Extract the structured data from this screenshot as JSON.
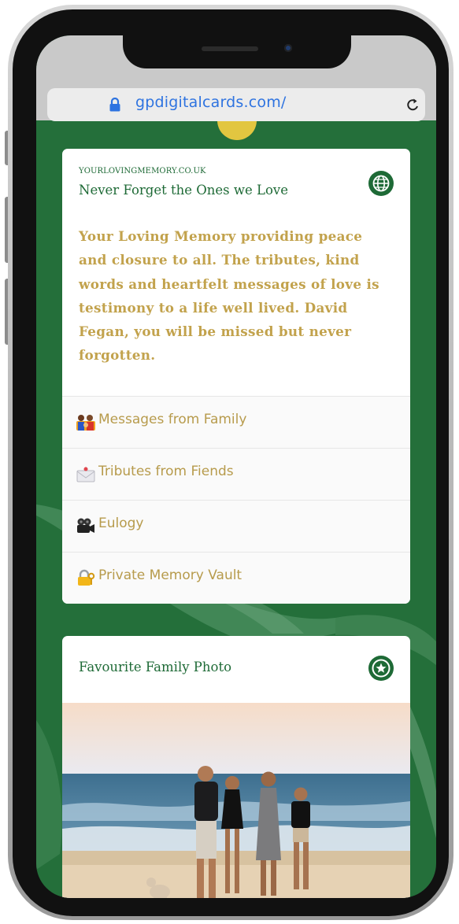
{
  "browser": {
    "url": "gpdigitalcards.com/"
  },
  "card_memory": {
    "site_caption": "YOURLOVINGMEMORY.CO.UK",
    "title": "Never Forget the Ones we Love",
    "body": "Your Loving Memory providing peace and closure to all. The tributes, kind words and heartfelt messages of love is testimony to a life well lived. David Fegan, you will be missed but never forgotten.",
    "icon": "globe-icon"
  },
  "menu": {
    "items": [
      {
        "label": "Messages from Family",
        "icon": "family-icon"
      },
      {
        "label": "Tributes from Fiends",
        "icon": "envelope-icon"
      },
      {
        "label": "Eulogy",
        "icon": "movie-camera-icon"
      },
      {
        "label": "Private Memory Vault",
        "icon": "lock-key-icon"
      }
    ]
  },
  "card_photo": {
    "title": "Favourite Family Photo",
    "icon": "star-icon",
    "photo": "family-walking-on-beach"
  },
  "colors": {
    "page_green": "#246f3a",
    "title_green": "#1e6a36",
    "gold_text": "#c2a24c",
    "link_blue": "#2e73e0"
  }
}
